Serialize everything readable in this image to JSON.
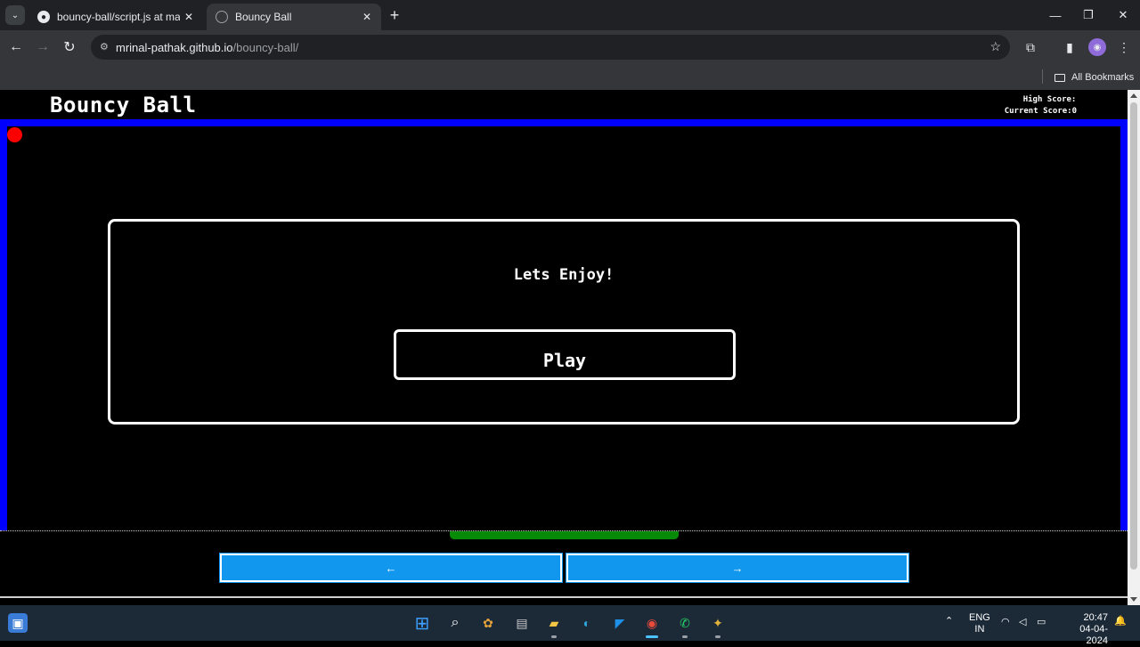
{
  "browser": {
    "tabs": [
      {
        "title": "bouncy-ball/script.js at master · ",
        "icon": "github-icon",
        "active": false
      },
      {
        "title": "Bouncy Ball",
        "icon": "globe-icon",
        "active": true
      }
    ],
    "url_host": "mrinal-pathak.github.io",
    "url_path": "/bouncy-ball/",
    "bookmarks_label": "All Bookmarks"
  },
  "game": {
    "title": "Bouncy Ball",
    "high_score_label": "High Score:",
    "high_score_value": "",
    "current_score_label": "Current Score:",
    "current_score_value": "0",
    "message": "Lets Enjoy!",
    "play_label": "Play",
    "left_label": "←",
    "right_label": "→",
    "colors": {
      "border": "#0000ff",
      "ball": "#ff0000",
      "paddle": "#078a07",
      "control": "#1297ee"
    }
  },
  "taskbar": {
    "lang_top": "ENG",
    "lang_bottom": "IN",
    "time": "20:47",
    "date": "04-04-2024"
  }
}
